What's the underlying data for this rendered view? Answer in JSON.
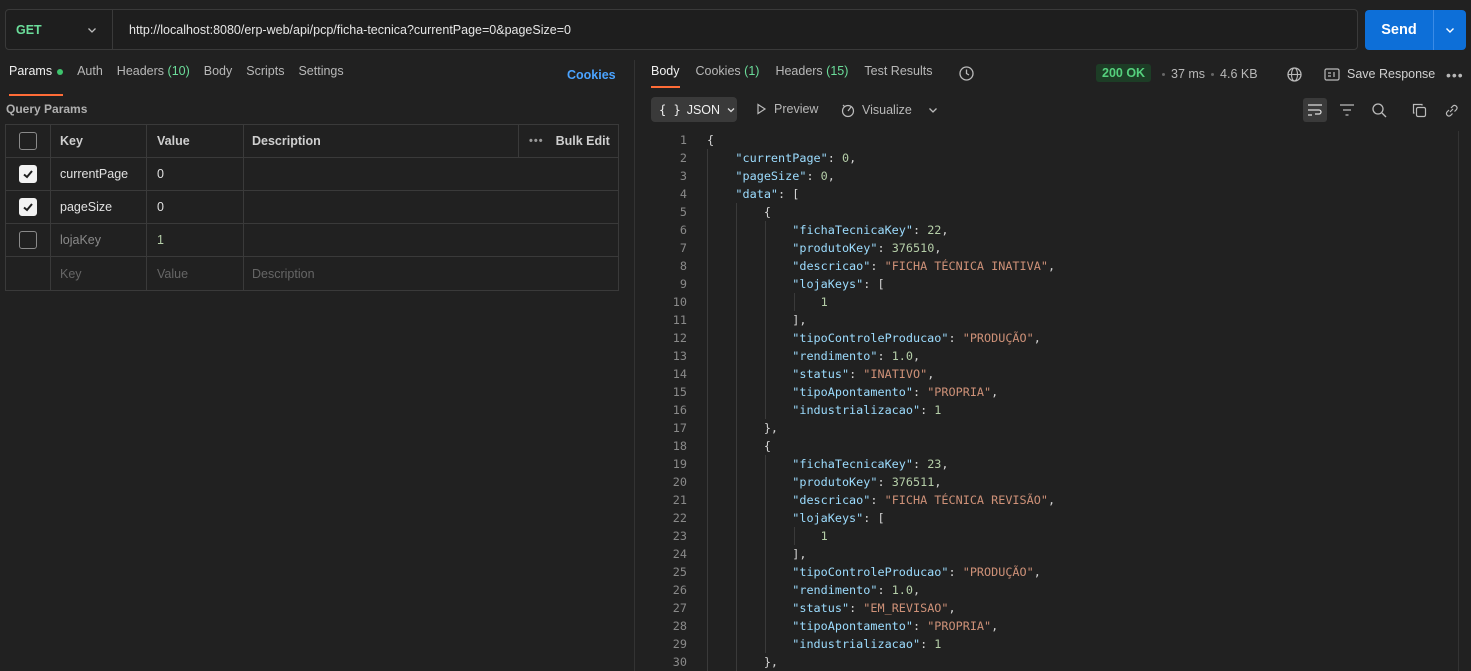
{
  "request": {
    "method": "GET",
    "url": "http://localhost:8080/erp-web/api/pcp/ficha-tecnica?currentPage=0&pageSize=0",
    "send_label": "Send"
  },
  "request_tabs": [
    {
      "label": "Params",
      "count": "",
      "active": true,
      "dot": true
    },
    {
      "label": "Auth",
      "count": ""
    },
    {
      "label": "Headers",
      "count": "(10)"
    },
    {
      "label": "Body",
      "count": ""
    },
    {
      "label": "Scripts",
      "count": ""
    },
    {
      "label": "Settings",
      "count": ""
    }
  ],
  "cookies_link": "Cookies",
  "query_params": {
    "title": "Query Params",
    "headers": {
      "key": "Key",
      "value": "Value",
      "description": "Description",
      "bulk_edit": "Bulk Edit"
    },
    "rows": [
      {
        "checked": true,
        "key": "currentPage",
        "value": "0",
        "description": ""
      },
      {
        "checked": true,
        "key": "pageSize",
        "value": "0",
        "description": ""
      },
      {
        "checked": false,
        "key": "lojaKey",
        "value": "1",
        "description": ""
      }
    ],
    "placeholder": {
      "key": "Key",
      "value": "Value",
      "description": "Description"
    }
  },
  "response_tabs": [
    {
      "label": "Body",
      "count": "",
      "active": true
    },
    {
      "label": "Cookies",
      "count": "(1)"
    },
    {
      "label": "Headers",
      "count": "(15)"
    },
    {
      "label": "Test Results",
      "count": ""
    }
  ],
  "response_meta": {
    "status": "200 OK",
    "time": "37 ms",
    "size": "4.6 KB",
    "save_label": "Save Response"
  },
  "body_toolbar": {
    "format": "JSON",
    "preview": "Preview",
    "visualize": "Visualize"
  },
  "colors": {
    "accent_tab": "#ff6c37",
    "send_button": "#0d6fd8",
    "status_ok": "#55d07d",
    "json_key": "#9cdcfe",
    "json_string": "#ce9178",
    "json_number": "#b5cea8"
  },
  "code_lines": [
    {
      "n": "1",
      "t": "{"
    },
    {
      "n": "2",
      "t": "    \"currentPage\": 0,"
    },
    {
      "n": "3",
      "t": "    \"pageSize\": 0,"
    },
    {
      "n": "4",
      "t": "    \"data\": ["
    },
    {
      "n": "5",
      "t": "        {"
    },
    {
      "n": "6",
      "t": "            \"fichaTecnicaKey\": 22,"
    },
    {
      "n": "7",
      "t": "            \"produtoKey\": 376510,"
    },
    {
      "n": "8",
      "t": "            \"descricao\": \"FICHA TÉCNICA INATIVA\","
    },
    {
      "n": "9",
      "t": "            \"lojaKeys\": ["
    },
    {
      "n": "10",
      "t": "                1"
    },
    {
      "n": "11",
      "t": "            ],"
    },
    {
      "n": "12",
      "t": "            \"tipoControleProducao\": \"PRODUÇÃO\","
    },
    {
      "n": "13",
      "t": "            \"rendimento\": 1.0,"
    },
    {
      "n": "14",
      "t": "            \"status\": \"INATIVO\","
    },
    {
      "n": "15",
      "t": "            \"tipoApontamento\": \"PROPRIA\","
    },
    {
      "n": "16",
      "t": "            \"industrializacao\": 1"
    },
    {
      "n": "17",
      "t": "        },"
    },
    {
      "n": "18",
      "t": "        {"
    },
    {
      "n": "19",
      "t": "            \"fichaTecnicaKey\": 23,"
    },
    {
      "n": "20",
      "t": "            \"produtoKey\": 376511,"
    },
    {
      "n": "21",
      "t": "            \"descricao\": \"FICHA TÉCNICA REVISÃO\","
    },
    {
      "n": "22",
      "t": "            \"lojaKeys\": ["
    },
    {
      "n": "23",
      "t": "                1"
    },
    {
      "n": "24",
      "t": "            ],"
    },
    {
      "n": "25",
      "t": "            \"tipoControleProducao\": \"PRODUÇÃO\","
    },
    {
      "n": "26",
      "t": "            \"rendimento\": 1.0,"
    },
    {
      "n": "27",
      "t": "            \"status\": \"EM_REVISAO\","
    },
    {
      "n": "28",
      "t": "            \"tipoApontamento\": \"PROPRIA\","
    },
    {
      "n": "29",
      "t": "            \"industrializacao\": 1"
    },
    {
      "n": "30",
      "t": "        },"
    }
  ]
}
